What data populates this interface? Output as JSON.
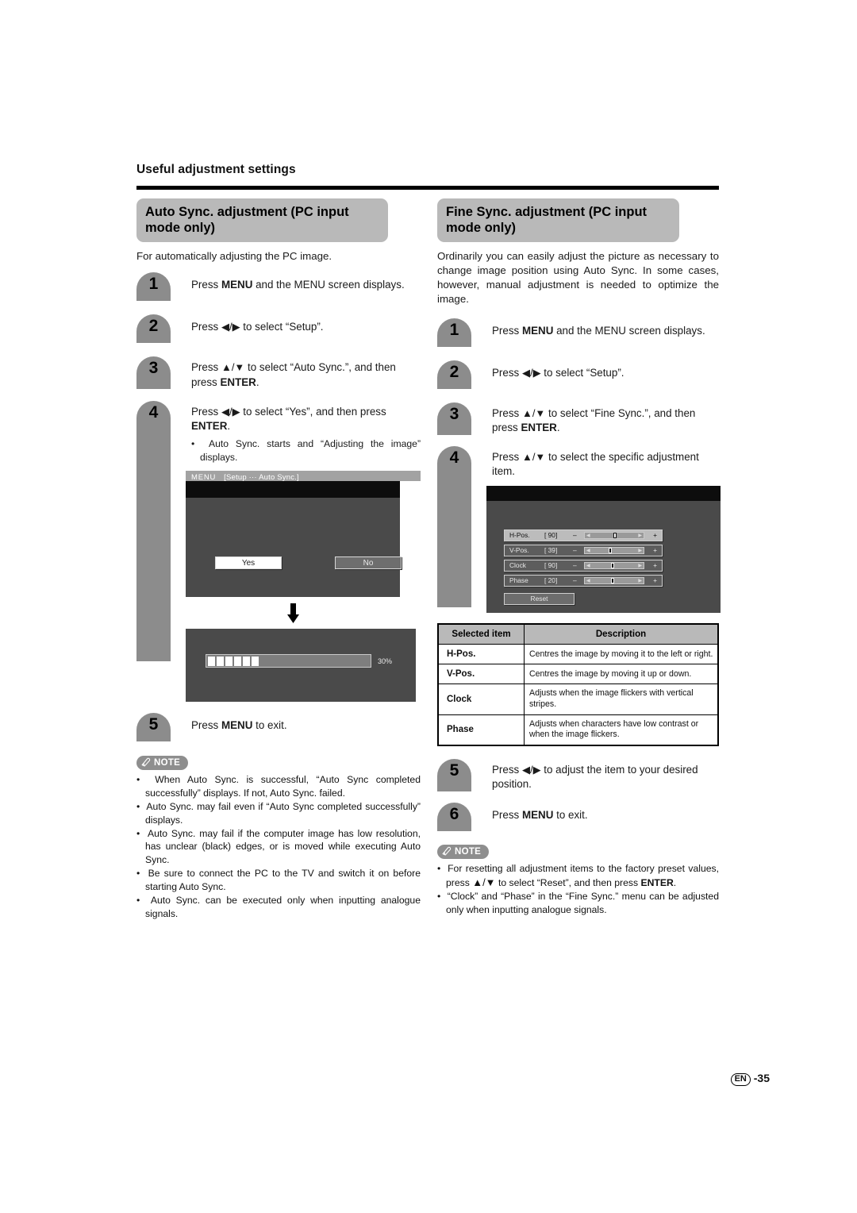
{
  "page": {
    "section_title": "Useful adjustment settings",
    "footer_lang": "EN",
    "footer_page": "-35"
  },
  "left": {
    "heading": "Auto Sync. adjustment (PC input mode only)",
    "intro": "For automatically adjusting the PC image.",
    "steps": [
      {
        "num": "1",
        "text_pre": "Press ",
        "bold": "MENU",
        "text_post": " and the MENU screen displays."
      },
      {
        "num": "2",
        "text_pre": "Press ",
        "arrows": "◀/▶",
        "text_post": " to select “Setup”."
      },
      {
        "num": "3",
        "text_pre": "Press ",
        "arrows": "▲/▼",
        "text_mid": " to select “Auto Sync.”, and then press ",
        "bold": "ENTER",
        "text_post": "."
      },
      {
        "num": "4",
        "text_pre": "Press ",
        "arrows": "◀/▶",
        "text_mid": " to select “Yes”, and then press ",
        "bold": "ENTER",
        "text_post": ".",
        "bullet": "Auto Sync. starts and “Adjusting the image” displays."
      },
      {
        "num": "5",
        "text_pre": "Press ",
        "bold": "MENU",
        "text_post": " to exit."
      }
    ],
    "osd_confirm": {
      "menu_label": "MENU",
      "path_label": "[Setup ··· Auto Sync.]",
      "yes_label": "Yes",
      "no_label": "No"
    },
    "osd_progress": {
      "percent_label": "30%",
      "percent_value": 30,
      "block_count": 6
    },
    "note": {
      "badge": "NOTE",
      "items": [
        "When Auto Sync. is successful, “Auto Sync completed successfully” displays. If not, Auto Sync. failed.",
        "Auto Sync. may fail even if “Auto Sync completed successfully” displays.",
        "Auto Sync. may fail if the computer image has low resolution, has unclear (black) edges, or is moved while executing Auto Sync.",
        "Be sure to connect the PC to the TV and switch it on before starting Auto Sync.",
        "Auto Sync. can be executed only when inputting analogue signals."
      ]
    }
  },
  "right": {
    "heading": "Fine Sync. adjustment (PC input mode only)",
    "intro": "Ordinarily you can easily adjust the picture as necessary to change image position using Auto Sync. In some cases, however, manual adjustment is needed to optimize the image.",
    "steps": [
      {
        "num": "1",
        "text_pre": "Press ",
        "bold": "MENU",
        "text_post": " and the MENU screen displays."
      },
      {
        "num": "2",
        "text_pre": "Press ",
        "arrows": "◀/▶",
        "text_post": " to select “Setup”."
      },
      {
        "num": "3",
        "text_pre": "Press ",
        "arrows": "▲/▼",
        "text_mid": " to select “Fine Sync.”, and then press ",
        "bold": "ENTER",
        "text_post": "."
      },
      {
        "num": "4",
        "text_pre": "Press ",
        "arrows": "▲/▼",
        "text_post": " to select the specific adjustment item."
      },
      {
        "num": "5",
        "text_pre": "Press ",
        "arrows": "◀/▶",
        "text_post": " to adjust the item to your desired position."
      },
      {
        "num": "6",
        "text_pre": "Press ",
        "bold": "MENU",
        "text_post": " to exit."
      }
    ],
    "osd_finesync": {
      "rows": [
        {
          "label": "H-Pos.",
          "value": "[ 90]",
          "minus": "–",
          "plus": "+",
          "knob_pct": 50,
          "selected": true
        },
        {
          "label": "V-Pos.",
          "value": "[ 39]",
          "minus": "–",
          "plus": "+",
          "knob_pct": 42,
          "selected": false
        },
        {
          "label": "Clock",
          "value": "[ 90]",
          "minus": "–",
          "plus": "+",
          "knob_pct": 47,
          "selected": false
        },
        {
          "label": "Phase",
          "value": "[ 20]",
          "minus": "–",
          "plus": "+",
          "knob_pct": 47,
          "selected": false
        }
      ],
      "reset_label": "Reset"
    },
    "table": {
      "headers": [
        "Selected item",
        "Description"
      ],
      "rows": [
        {
          "item": "H-Pos.",
          "desc": "Centres the image by moving it to the left or right."
        },
        {
          "item": "V-Pos.",
          "desc": "Centres the image by moving it up or down."
        },
        {
          "item": "Clock",
          "desc": "Adjusts when the image flickers with vertical stripes."
        },
        {
          "item": "Phase",
          "desc": "Adjusts when characters have low contrast or when the image flickers."
        }
      ]
    },
    "note": {
      "badge": "NOTE",
      "items": [
        {
          "pre": "For resetting all adjustment items to the factory preset values, press ",
          "arrows": "▲/▼",
          "mid": " to select “Reset”, and then press ",
          "bold": "ENTER",
          "post": "."
        },
        {
          "pre": "“Clock” and “Phase” in the “Fine Sync.” menu can be adjusted only when inputting analogue signals."
        }
      ]
    }
  }
}
